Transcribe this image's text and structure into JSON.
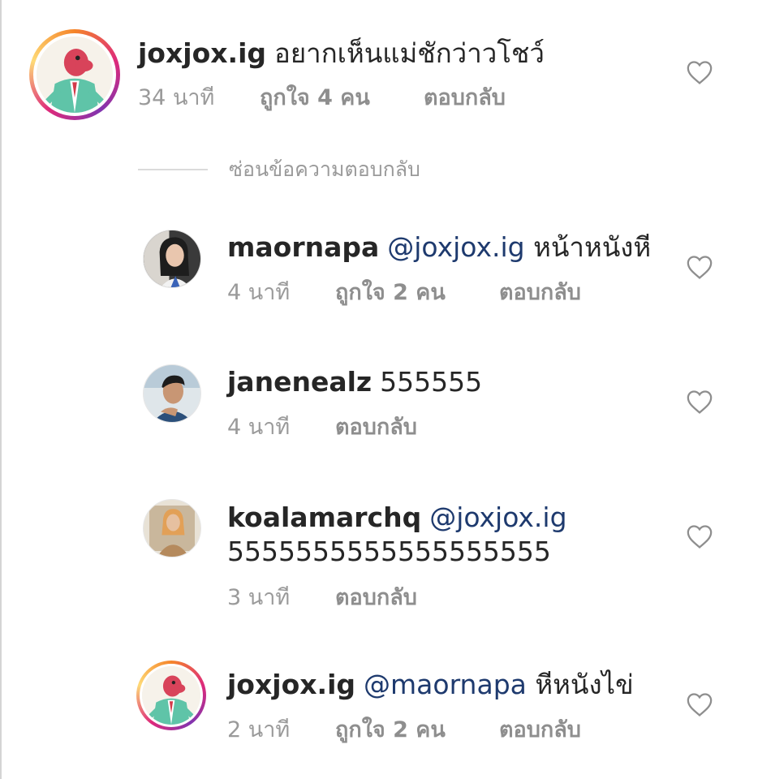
{
  "comments": [
    {
      "username": "joxjox.ig",
      "mention": "",
      "text": "อยากเห็นแม่ชักว่าวโชว์",
      "time": "34 นาที",
      "likes": "ถูกใจ 4 คน",
      "reply": "ตอบกลับ"
    },
    {
      "username": "maornapa",
      "mention": "@joxjox.ig",
      "text": "หน้าหนังหี",
      "time": "4 นาที",
      "likes": "ถูกใจ 2 คน",
      "reply": "ตอบกลับ"
    },
    {
      "username": "janenealz",
      "mention": "",
      "text": "555555",
      "time": "4 นาที",
      "likes": "",
      "reply": "ตอบกลับ"
    },
    {
      "username": "koalamarchq",
      "mention": "@joxjox.ig",
      "text": "5555555555555555555",
      "time": "3 นาที",
      "likes": "",
      "reply": "ตอบกลับ"
    },
    {
      "username": "joxjox.ig",
      "mention": "@maornapa",
      "text": "หีหนังไข่",
      "time": "2 นาที",
      "likes": "ถูกใจ 2 คน",
      "reply": "ตอบกลับ"
    }
  ],
  "hide_replies_label": "ซ่อนข้อความตอบกลับ",
  "icons": {
    "like": "heart-outline-icon"
  },
  "colors": {
    "story_ring": "#dd2a7b",
    "mention": "#1e3a6e",
    "meta": "#9a9a9a"
  }
}
